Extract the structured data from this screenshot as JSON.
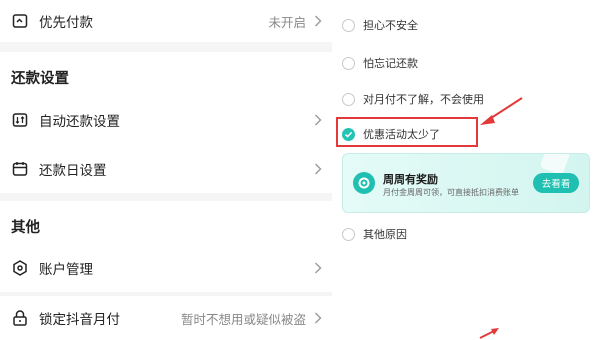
{
  "settings": {
    "priority_pay": {
      "label": "优先付款",
      "value": "未开启"
    },
    "repayment_section_title": "还款设置",
    "auto_repay": {
      "label": "自动还款设置"
    },
    "repay_day": {
      "label": "还款日设置"
    },
    "other_section_title": "其他",
    "account": {
      "label": "账户管理"
    },
    "lock": {
      "label": "锁定抖音月付",
      "value": "暂时不想用或疑似被盗"
    }
  },
  "reasons": {
    "options": [
      {
        "label": "担心不安全",
        "checked": false
      },
      {
        "label": "怕忘记还款",
        "checked": false
      },
      {
        "label": "对月付不了解，不会使用",
        "checked": false
      },
      {
        "label": "优惠活动太少了",
        "checked": true
      },
      {
        "label": "其他原因",
        "checked": false
      }
    ],
    "promo": {
      "title": "周周有奖励",
      "subtitle": "月付金周周可领，可直接抵扣消费账单",
      "button": "去看看"
    }
  },
  "colors": {
    "accent": "#1fc0b1",
    "highlight": "#e23a3a",
    "separator": "#f5f5f5"
  },
  "icons": {
    "priority": "clock-card-icon",
    "auto_repay": "repay-card-icon",
    "repay_day": "calendar-icon",
    "account": "shield-hex-icon",
    "lock": "lock-icon"
  }
}
